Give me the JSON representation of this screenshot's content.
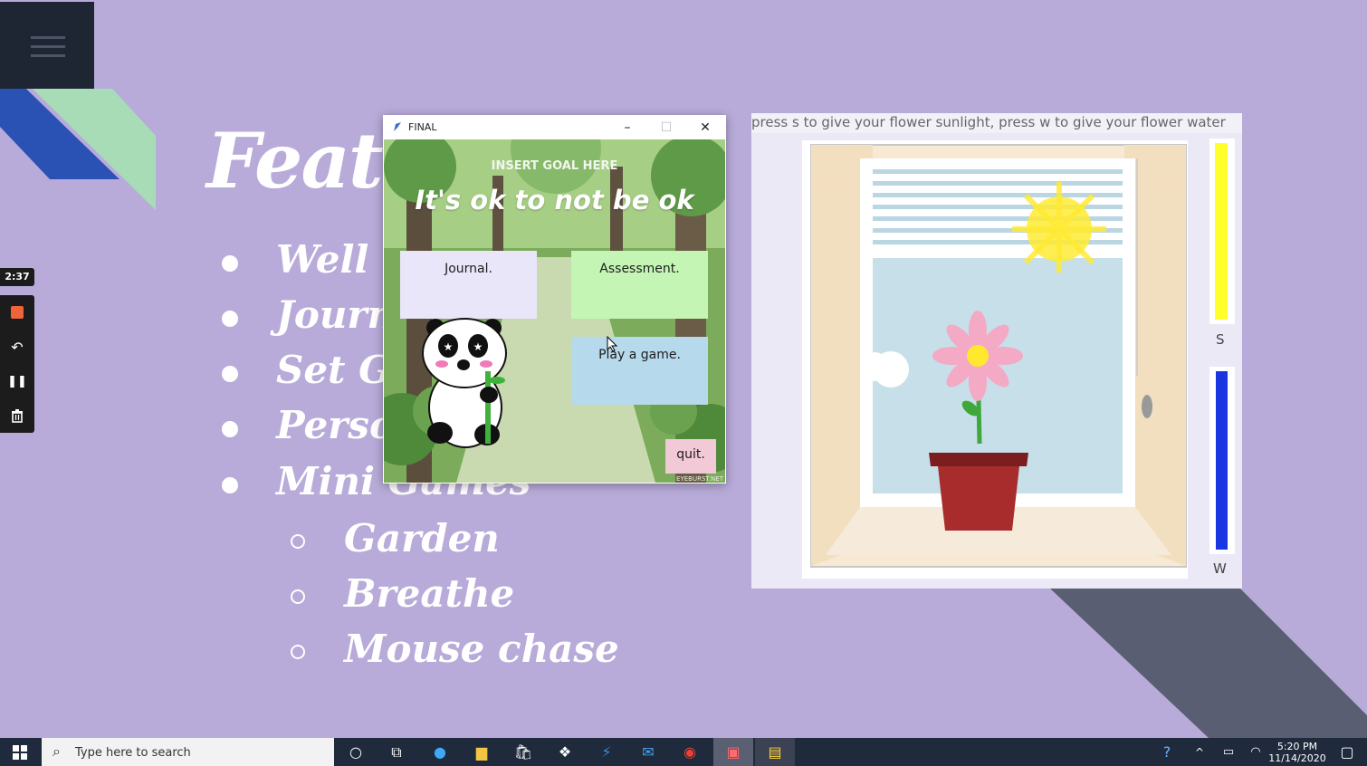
{
  "slide": {
    "heading": "Featu",
    "bullets": [
      "Well be",
      "Journa",
      "Set Go",
      "Person",
      "Mini Games"
    ],
    "sub_bullets": [
      "Garden",
      "Breathe",
      "Mouse chase"
    ]
  },
  "recorder": {
    "timer": "2:37",
    "icons": [
      "stop-icon",
      "undo-icon",
      "pause-icon",
      "trash-icon"
    ]
  },
  "window": {
    "title": "FINAL",
    "minimize": "–",
    "maximize": "☐",
    "close": "✕",
    "goal_placeholder": "INSERT GOAL HERE",
    "quote": "It's ok to not be ok",
    "buttons": {
      "journal": "Journal.",
      "assessment": "Assessment.",
      "play_game": "Play a game.",
      "quit": "quit."
    },
    "credit": "EYEBURST.NET",
    "colors": {
      "journal": "#e8e6f8",
      "assessment": "#c4f5b4",
      "play_game": "#b6d9ec",
      "quit": "#f2c9d6"
    }
  },
  "garden": {
    "instructions": "press s to give your flower sunlight, press w to give your flower water",
    "sun_label": "S",
    "water_label": "W",
    "sun_level": 1.0,
    "water_level": 1.0,
    "colors": {
      "sun": "#ffff2a",
      "water": "#1a36e0"
    }
  },
  "taskbar": {
    "search_placeholder": "Type here to search",
    "time": "5:20 PM",
    "date": "11/14/2020"
  }
}
